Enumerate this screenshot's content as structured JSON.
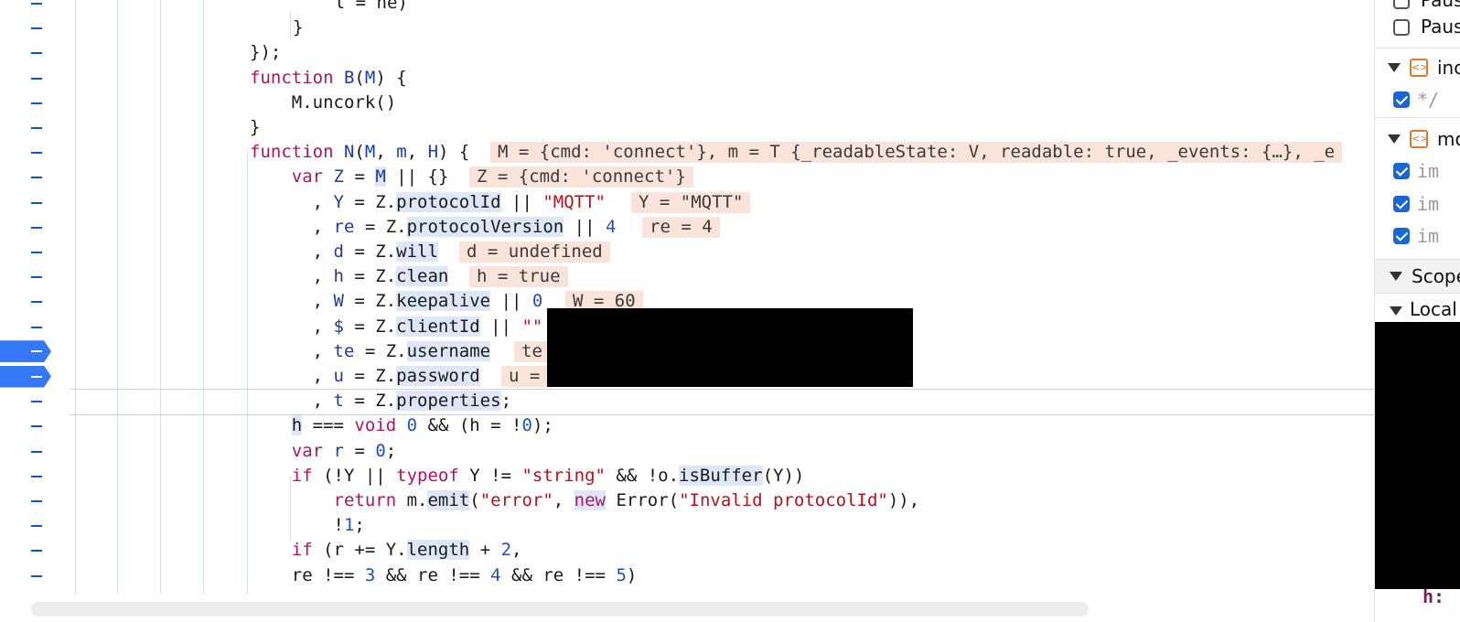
{
  "editor": {
    "lines": [
      {
        "indent": 0,
        "segments": [
          [
            "    ",
            ""
          ],
          [
            "l = ne)",
            ""
          ]
        ]
      },
      {
        "indent": 0,
        "segments": [
          [
            "}",
            ""
          ]
        ]
      },
      {
        "indent": 0,
        "segments": [
          [
            "});",
            ""
          ]
        ]
      },
      {
        "indent": 0,
        "segments": [
          [
            "function",
            "kw"
          ],
          [
            " ",
            ""
          ],
          [
            "B",
            "var"
          ],
          [
            "(",
            ""
          ],
          [
            "M",
            "var"
          ],
          [
            ") {",
            ""
          ]
        ]
      },
      {
        "indent": 0,
        "segments": [
          [
            "    M.uncork()",
            ""
          ]
        ]
      },
      {
        "indent": 0,
        "segments": [
          [
            "}",
            ""
          ]
        ]
      },
      {
        "indent": 0,
        "segments": [
          [
            "function",
            "kw"
          ],
          [
            " ",
            ""
          ],
          [
            "N",
            "var"
          ],
          [
            "(",
            ""
          ],
          [
            "M",
            "var"
          ],
          [
            ", ",
            ""
          ],
          [
            "m",
            "var"
          ],
          [
            ", ",
            ""
          ],
          [
            "H",
            "var"
          ],
          [
            ") {",
            ""
          ]
        ]
      },
      {
        "indent": 0,
        "segments": [
          [
            "    ",
            ""
          ],
          [
            "var",
            "kw"
          ],
          [
            " ",
            ""
          ],
          [
            "Z",
            "var"
          ],
          [
            " = ",
            ""
          ],
          [
            "M",
            "var hv"
          ],
          [
            " || {}",
            ""
          ]
        ]
      },
      {
        "indent": 0,
        "segments": [
          [
            "      , ",
            ""
          ],
          [
            "Y",
            "var"
          ],
          [
            " = Z.",
            ""
          ],
          [
            "protocolId",
            "hv"
          ],
          [
            " || ",
            ""
          ],
          [
            "\"MQTT\"",
            "str"
          ]
        ]
      },
      {
        "indent": 0,
        "segments": [
          [
            "      , ",
            ""
          ],
          [
            "re",
            "var"
          ],
          [
            " = Z.",
            ""
          ],
          [
            "protocolVersion",
            "hv"
          ],
          [
            " || ",
            ""
          ],
          [
            "4",
            "num"
          ]
        ]
      },
      {
        "indent": 0,
        "segments": [
          [
            "      , ",
            ""
          ],
          [
            "d",
            "var"
          ],
          [
            " = Z.",
            ""
          ],
          [
            "will",
            "hv"
          ]
        ]
      },
      {
        "indent": 0,
        "segments": [
          [
            "      , ",
            ""
          ],
          [
            "h",
            "var"
          ],
          [
            " = Z.",
            ""
          ],
          [
            "clean",
            "hv"
          ]
        ]
      },
      {
        "indent": 0,
        "segments": [
          [
            "      , ",
            ""
          ],
          [
            "W",
            "var"
          ],
          [
            " = Z.",
            ""
          ],
          [
            "keepalive",
            "hv"
          ],
          [
            " || ",
            ""
          ],
          [
            "0",
            "num"
          ]
        ]
      },
      {
        "indent": 0,
        "segments": [
          [
            "      , ",
            ""
          ],
          [
            "$",
            "var"
          ],
          [
            " = Z.",
            ""
          ],
          [
            "clientId",
            "hv"
          ],
          [
            " || ",
            ""
          ],
          [
            "\"\"",
            "str"
          ]
        ]
      },
      {
        "indent": 0,
        "segments": [
          [
            "      , ",
            ""
          ],
          [
            "te",
            "var"
          ],
          [
            " = Z.",
            ""
          ],
          [
            "username",
            "hv"
          ]
        ]
      },
      {
        "indent": 0,
        "segments": [
          [
            "      , ",
            ""
          ],
          [
            "u",
            "var"
          ],
          [
            " = Z.",
            ""
          ],
          [
            "password",
            "hv"
          ]
        ]
      },
      {
        "indent": 0,
        "segments": [
          [
            "      , ",
            ""
          ],
          [
            "t",
            "var"
          ],
          [
            " = Z.",
            ""
          ],
          [
            "properties",
            "hv"
          ],
          [
            ";",
            ""
          ]
        ]
      },
      {
        "indent": 0,
        "segments": [
          [
            "    ",
            ""
          ],
          [
            "h",
            "hv"
          ],
          [
            " === ",
            ""
          ],
          [
            "void",
            "kw"
          ],
          [
            " ",
            ""
          ],
          [
            "0",
            "num"
          ],
          [
            " && (h = !",
            ""
          ],
          [
            "0",
            "num"
          ],
          [
            ");",
            ""
          ]
        ]
      },
      {
        "indent": 0,
        "segments": [
          [
            "    ",
            ""
          ],
          [
            "var",
            "kw"
          ],
          [
            " ",
            ""
          ],
          [
            "r",
            "var"
          ],
          [
            " = ",
            ""
          ],
          [
            "0",
            "num"
          ],
          [
            ";",
            ""
          ]
        ]
      },
      {
        "indent": 0,
        "segments": [
          [
            "    ",
            ""
          ],
          [
            "if",
            "kw"
          ],
          [
            " (!Y || ",
            ""
          ],
          [
            "typeof",
            "kw"
          ],
          [
            " Y != ",
            ""
          ],
          [
            "\"string\"",
            "str"
          ],
          [
            " && !o.",
            ""
          ],
          [
            "isBuffer",
            "hv"
          ],
          [
            "(Y))",
            ""
          ]
        ]
      },
      {
        "indent": 0,
        "segments": [
          [
            "        ",
            ""
          ],
          [
            "return",
            "kw"
          ],
          [
            " m.",
            ""
          ],
          [
            "emit",
            "hv"
          ],
          [
            "(",
            ""
          ],
          [
            "\"error\"",
            "str"
          ],
          [
            ", ",
            ""
          ],
          [
            "new",
            "kw hv"
          ],
          [
            " Error(",
            ""
          ],
          [
            "\"Invalid protocolId\"",
            "str"
          ],
          [
            ")),",
            ""
          ]
        ]
      },
      {
        "indent": 0,
        "segments": [
          [
            "        !",
            ""
          ],
          [
            "1",
            "num"
          ],
          [
            ";",
            ""
          ]
        ]
      },
      {
        "indent": 0,
        "segments": [
          [
            "    ",
            ""
          ],
          [
            "if",
            "kw"
          ],
          [
            " (r += Y.",
            ""
          ],
          [
            "length",
            "hv"
          ],
          [
            " + ",
            ""
          ],
          [
            "2",
            "num"
          ],
          [
            ",",
            ""
          ]
        ]
      },
      {
        "indent": 0,
        "segments": [
          [
            "    re !== ",
            ""
          ],
          [
            "3",
            "num"
          ],
          [
            " && re !== ",
            ""
          ],
          [
            "4",
            "num"
          ],
          [
            " && re !== ",
            ""
          ],
          [
            "5",
            "num"
          ],
          [
            ")",
            ""
          ]
        ]
      }
    ],
    "annotations": [
      {
        "row": 6,
        "text": "M = {cmd: 'connect'}, m = T {_readableState: V, readable: true, _events: {…}, _e"
      },
      {
        "row": 7,
        "text": "Z = {cmd: 'connect'}"
      },
      {
        "row": 8,
        "text": "Y = \"MQTT\""
      },
      {
        "row": 9,
        "text": "re = 4"
      },
      {
        "row": 10,
        "text": "d = undefined"
      },
      {
        "row": 11,
        "text": "h = true"
      },
      {
        "row": 12,
        "text": "W = 60"
      },
      {
        "row": 14,
        "text": "te"
      },
      {
        "row": 15,
        "text": "u ="
      }
    ]
  },
  "sidebar": {
    "pause_1": "Paus",
    "pause_2": "Paus",
    "source_1_name": "inc",
    "source_1_item": "*/",
    "source_2_name": "mo",
    "source_2_items": [
      "im",
      "im",
      "im"
    ],
    "scope_label": "Scope",
    "local_label": "Local",
    "bottom_var": "h:"
  },
  "colors": {
    "breakpoint": "#3478f6",
    "annotation_bg": "#fae3d8",
    "highlight_line": "#f0d36a"
  }
}
